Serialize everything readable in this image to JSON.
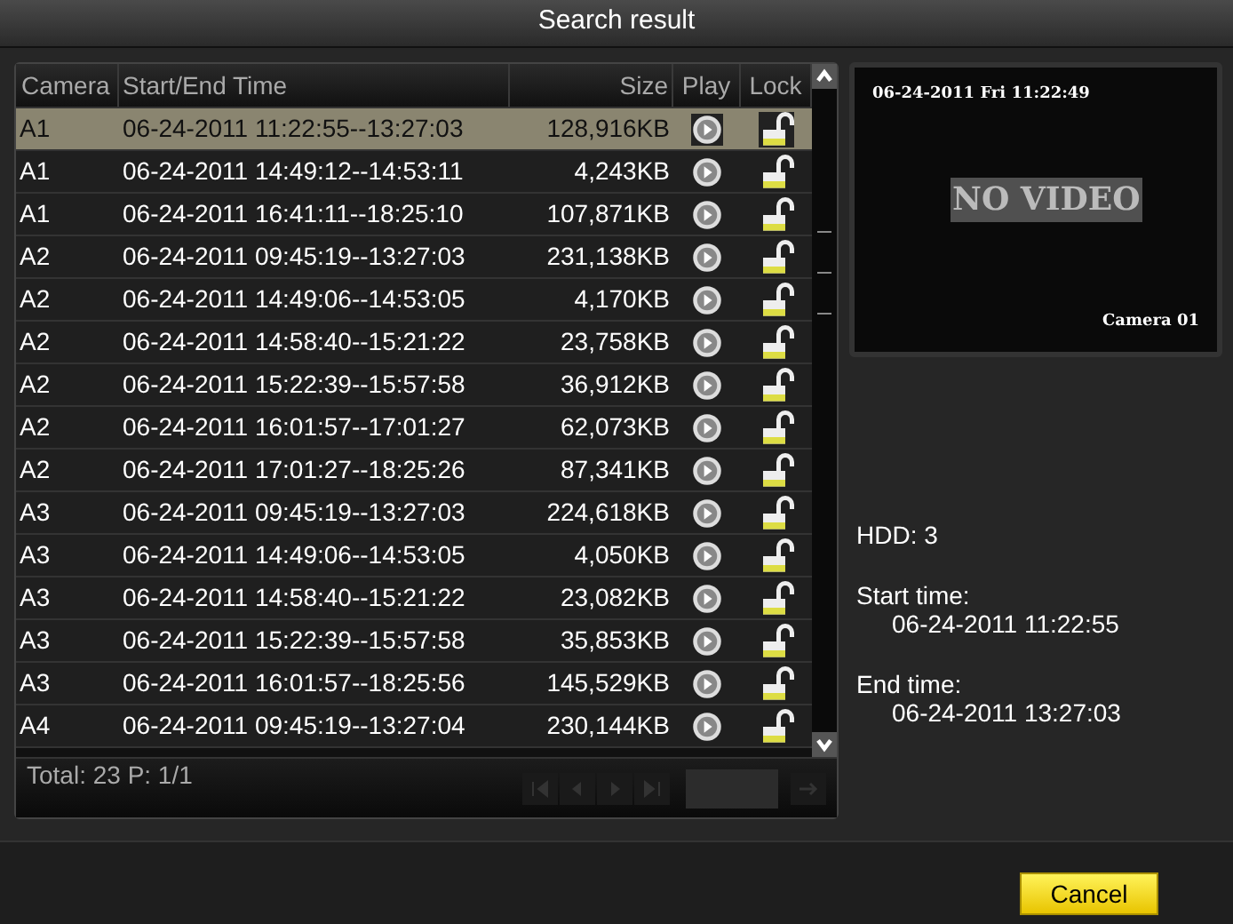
{
  "window": {
    "title": "Search result"
  },
  "table": {
    "columns": [
      "Camera",
      "Start/End Time",
      "Size",
      "Play",
      "Lock"
    ],
    "rows": [
      {
        "camera": "A1",
        "time": "06-24-2011 11:22:55--13:27:03",
        "size": "128,916KB",
        "selected": true,
        "locked": false
      },
      {
        "camera": "A1",
        "time": "06-24-2011 14:49:12--14:53:11",
        "size": "4,243KB",
        "selected": false,
        "locked": false
      },
      {
        "camera": "A1",
        "time": "06-24-2011 16:41:11--18:25:10",
        "size": "107,871KB",
        "selected": false,
        "locked": false
      },
      {
        "camera": "A2",
        "time": "06-24-2011 09:45:19--13:27:03",
        "size": "231,138KB",
        "selected": false,
        "locked": false
      },
      {
        "camera": "A2",
        "time": "06-24-2011 14:49:06--14:53:05",
        "size": "4,170KB",
        "selected": false,
        "locked": false
      },
      {
        "camera": "A2",
        "time": "06-24-2011 14:58:40--15:21:22",
        "size": "23,758KB",
        "selected": false,
        "locked": false
      },
      {
        "camera": "A2",
        "time": "06-24-2011 15:22:39--15:57:58",
        "size": "36,912KB",
        "selected": false,
        "locked": false
      },
      {
        "camera": "A2",
        "time": "06-24-2011 16:01:57--17:01:27",
        "size": "62,073KB",
        "selected": false,
        "locked": false
      },
      {
        "camera": "A2",
        "time": "06-24-2011 17:01:27--18:25:26",
        "size": "87,341KB",
        "selected": false,
        "locked": false
      },
      {
        "camera": "A3",
        "time": "06-24-2011 09:45:19--13:27:03",
        "size": "224,618KB",
        "selected": false,
        "locked": false
      },
      {
        "camera": "A3",
        "time": "06-24-2011 14:49:06--14:53:05",
        "size": "4,050KB",
        "selected": false,
        "locked": false
      },
      {
        "camera": "A3",
        "time": "06-24-2011 14:58:40--15:21:22",
        "size": "23,082KB",
        "selected": false,
        "locked": false
      },
      {
        "camera": "A3",
        "time": "06-24-2011 15:22:39--15:57:58",
        "size": "35,853KB",
        "selected": false,
        "locked": false
      },
      {
        "camera": "A3",
        "time": "06-24-2011 16:01:57--18:25:56",
        "size": "145,529KB",
        "selected": false,
        "locked": false
      },
      {
        "camera": "A4",
        "time": "06-24-2011 09:45:19--13:27:04",
        "size": "230,144KB",
        "selected": false,
        "locked": false
      }
    ],
    "footer": "Total: 23  P: 1/1"
  },
  "preview": {
    "timestamp": "06-24-2011 Fri 11:22:49",
    "message": "NO VIDEO",
    "camera": "Camera 01"
  },
  "info": [
    {
      "label": "HDD: 3"
    },
    {
      "label": "Start time:",
      "value": "06-24-2011 11:22:55"
    },
    {
      "label": "End time:",
      "value": "06-24-2011 13:27:03"
    }
  ],
  "buttons": [
    "Cancel"
  ]
}
